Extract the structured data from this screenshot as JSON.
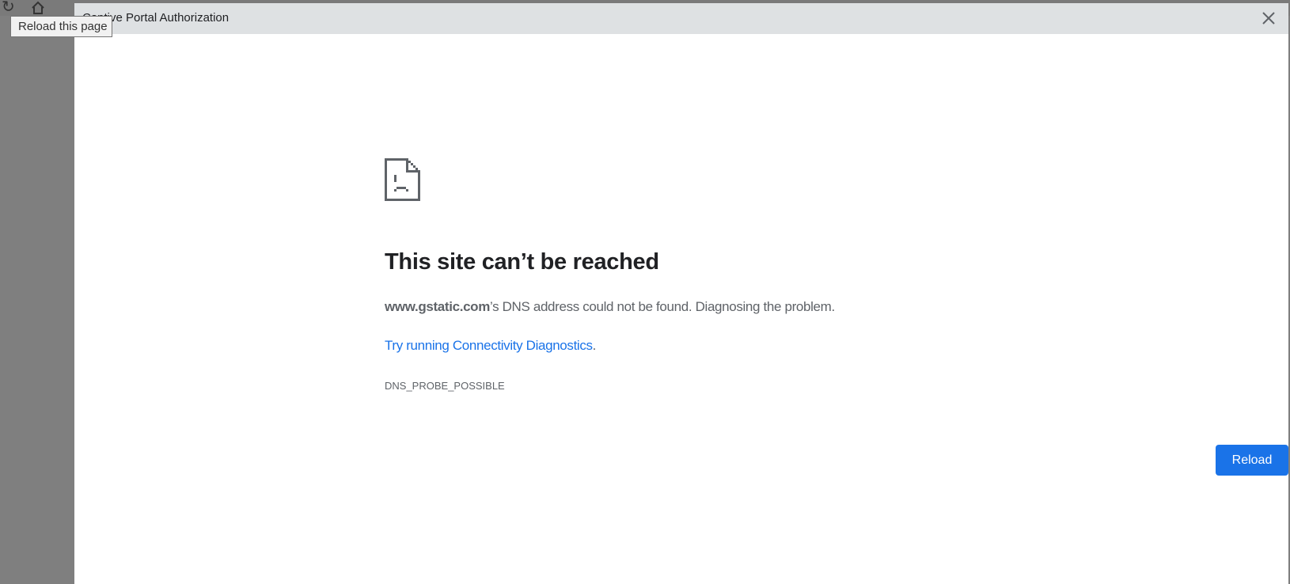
{
  "browser": {
    "tooltip": "Reload this page",
    "icons": [
      "reload-icon",
      "home-icon"
    ]
  },
  "dialog": {
    "title": "Captive Portal Authorization",
    "close_icon": "close-icon"
  },
  "error": {
    "icon": "sad-page-icon",
    "heading": "This site can’t be reached",
    "host": "www.gstatic.com",
    "message": "’s DNS address could not be found. Diagnosing the problem.",
    "link_text": "Try running Connectivity Diagnostics",
    "link_suffix": ".",
    "code": "DNS_PROBE_POSSIBLE",
    "reload_label": "Reload"
  },
  "colors": {
    "accent": "#1a73e8",
    "titlebar": "#dee1e3",
    "text": "#5f6368"
  }
}
